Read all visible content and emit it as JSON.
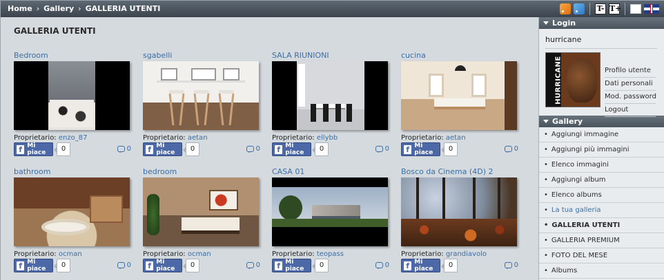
{
  "breadcrumb": [
    "Home",
    "Gallery",
    "GALLERIA UTENTI"
  ],
  "page_title": "GALLERIA UTENTI",
  "top_icons": {
    "font_decrease": "T-",
    "font_increase": "T+",
    "rss_icon": "rss-icon",
    "rss2_icon": "rss-comments-icon",
    "flag_it_icon": "flag-italy-icon",
    "flag_uk_icon": "flag-uk-icon"
  },
  "gallery": {
    "owner_label": "Proprietario: ",
    "fb_label": "Mi piace",
    "cards": [
      {
        "title": "Bedroom",
        "owner": "enzo_87",
        "likes": "0",
        "comments": "0",
        "thumb": "t-bedroom"
      },
      {
        "title": "sgabelli",
        "owner": "aetan",
        "likes": "0",
        "comments": "0",
        "thumb": "t-sgab"
      },
      {
        "title": "SALA RIUNIONI",
        "owner": "ellybb",
        "likes": "0",
        "comments": "0",
        "thumb": "t-sala"
      },
      {
        "title": "cucina",
        "owner": "aetan",
        "likes": "0",
        "comments": "0",
        "thumb": "t-cucina"
      },
      {
        "title": "bathroom",
        "owner": "ocman",
        "likes": "0",
        "comments": "0",
        "thumb": "t-bath"
      },
      {
        "title": "bedroom",
        "owner": "ocman",
        "likes": "0",
        "comments": "0",
        "thumb": "t-bedroom2"
      },
      {
        "title": "CASA 01",
        "owner": "teopass",
        "likes": "0",
        "comments": "0",
        "thumb": "t-casa"
      },
      {
        "title": "Bosco da Cinema (4D) 2",
        "owner": "grandiavolo",
        "likes": "0",
        "comments": "0",
        "thumb": "t-bosco"
      }
    ]
  },
  "sidebar": {
    "login_title": "Login",
    "username": "hurricane",
    "avatar_text": "HURRICANE",
    "user_links": [
      "Profilo utente",
      "Dati personali",
      "Mod. password",
      "Logout"
    ],
    "gallery_title": "Gallery",
    "gallery_items": [
      {
        "label": "Aggiungi immagine",
        "active": false,
        "bold": false
      },
      {
        "label": "Aggiungi più immagini",
        "active": false,
        "bold": false
      },
      {
        "label": "Elenco immagini",
        "active": false,
        "bold": false
      },
      {
        "label": "Aggiungi album",
        "active": false,
        "bold": false
      },
      {
        "label": "Elenco albums",
        "active": false,
        "bold": false
      },
      {
        "label": "La tua galleria",
        "active": true,
        "bold": false
      },
      {
        "label": "GALLERIA UTENTI",
        "active": false,
        "bold": true
      },
      {
        "label": "GALLERIA PREMIUM",
        "active": false,
        "bold": false
      },
      {
        "label": "FOTO DEL MESE",
        "active": false,
        "bold": false
      },
      {
        "label": "Albums",
        "active": false,
        "bold": false
      }
    ]
  }
}
